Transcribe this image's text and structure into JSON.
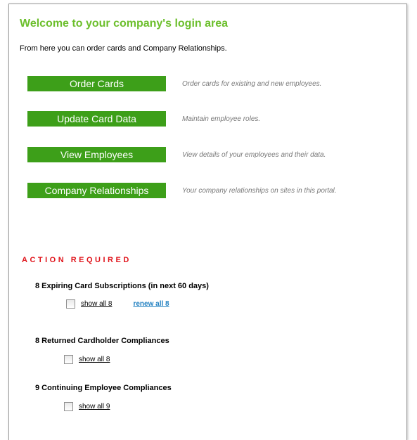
{
  "header": {
    "title": "Welcome to your company's login area",
    "intro": "From here you can order cards and Company Relationships."
  },
  "menu": [
    {
      "label": "Order Cards",
      "description": "Order cards for existing and new employees."
    },
    {
      "label": "Update Card Data",
      "description": "Maintain employee roles."
    },
    {
      "label": "View Employees",
      "description": "View details of your employees and their data."
    },
    {
      "label": "Company Relationships",
      "description": "Your company relationships on sites in this portal."
    }
  ],
  "actions": {
    "heading": "ACTION REQUIRED",
    "groups": [
      {
        "title": "8 Expiring Card Subscriptions (in next 60 days)",
        "show_label": "show all 8",
        "renew_label": "renew all 8"
      },
      {
        "title": "8 Returned Cardholder Compliances",
        "show_label": "show all 8"
      },
      {
        "title": "9 Continuing Employee Compliances",
        "show_label": "show all 9"
      }
    ]
  },
  "colors": {
    "title_green": "#6cbf2c",
    "button_green": "#3d9f19",
    "action_red": "#e0141b",
    "link_blue": "#1f7fc0"
  }
}
